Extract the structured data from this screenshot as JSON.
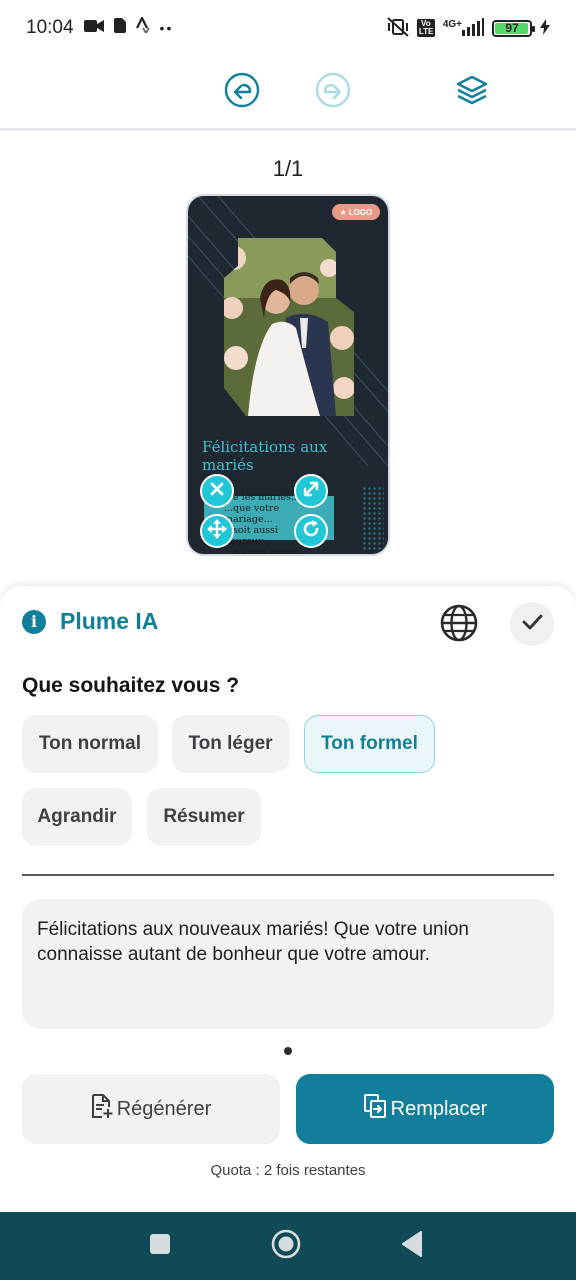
{
  "status_bar": {
    "time": "10:04",
    "overflow": "••",
    "network": "4G+",
    "volte": "Vo LTE",
    "battery_level": "97",
    "battery_fraction": 0.97,
    "icons": [
      "video-camera-icon",
      "sim-card-icon",
      "strava-icon",
      "vibrate-off-icon",
      "signal-icon",
      "charging-icon"
    ]
  },
  "toolbar": {
    "icons": [
      "undo-icon",
      "redo-icon",
      "layers-icon"
    ],
    "accent": "#0f7f9a"
  },
  "page_counter": "1/1",
  "preview": {
    "logo_badge": "LOGO",
    "title_text": "Félicitations aux mariés",
    "selected_text_lines": [
      "...e les mariés...",
      "...que votre mariage...",
      "...soit aussi heureux...",
      "...e votre amour..."
    ],
    "handles": [
      "close-handle-icon",
      "resize-handle-icon",
      "move-handle-icon",
      "rotate-handle-icon"
    ]
  },
  "sheet": {
    "title": "Plume IA",
    "question": "Que souhaitez vous ?",
    "tone_chips": [
      {
        "label": "Ton normal",
        "selected": false
      },
      {
        "label": "Ton léger",
        "selected": false
      },
      {
        "label": "Ton formel",
        "selected": true
      }
    ],
    "action_chips": [
      {
        "label": "Agrandir"
      },
      {
        "label": "Résumer"
      }
    ],
    "result_text": "Félicitations aux nouveaux mariés! Que votre union connaisse autant de bonheur que votre amour.",
    "regenerate_label": "Régénérer",
    "replace_label": "Remplacer",
    "quota": "Quota : 2 fois restantes"
  },
  "colors": {
    "accent": "#0f7f9a",
    "primary_button": "#117f9b",
    "nav_bar": "#0f4a56",
    "chip_bg": "#f0f2f4",
    "preview_bg": "#1f2730",
    "preview_text": "#3ec4d0"
  },
  "nav_bar": {
    "icons": [
      "recents-square-icon",
      "home-circle-icon",
      "back-triangle-icon"
    ]
  }
}
